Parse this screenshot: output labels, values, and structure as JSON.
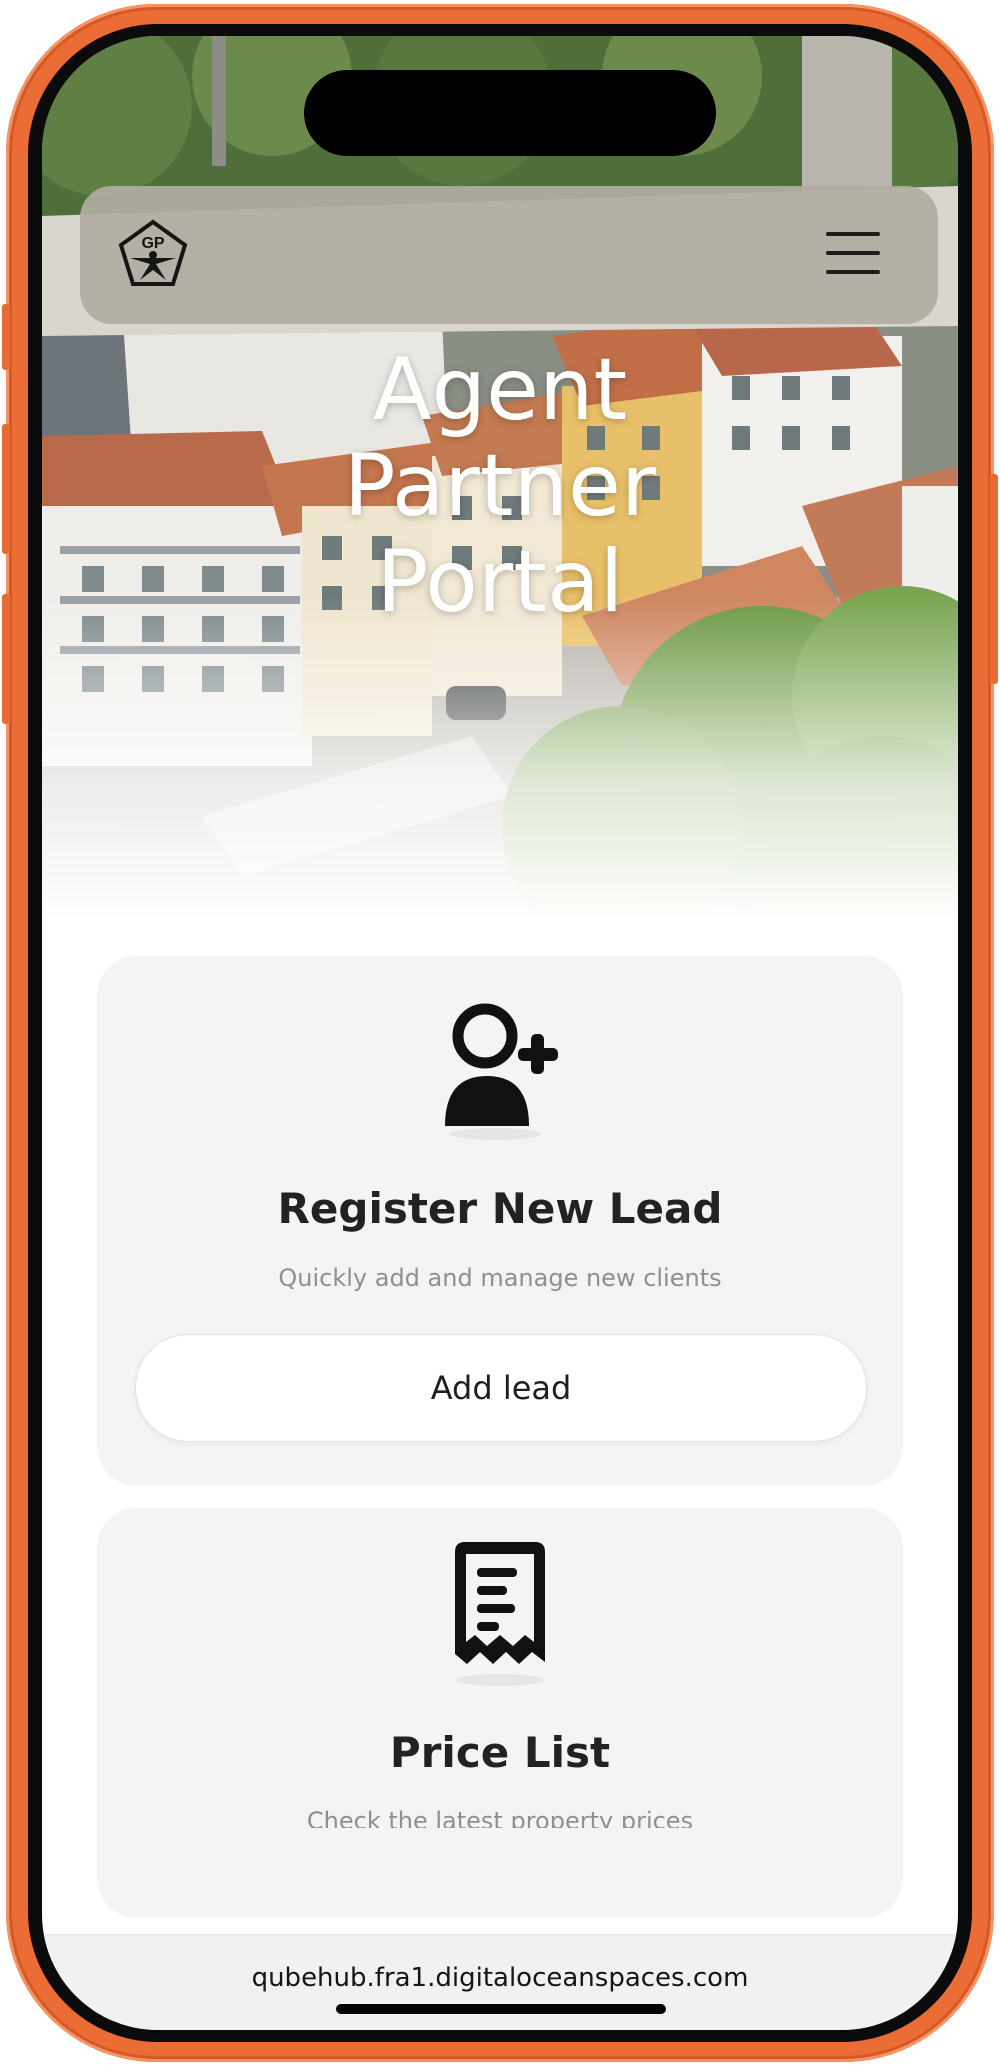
{
  "app": {
    "hero_title": [
      "Agent",
      "Partner",
      "Portal"
    ],
    "logo_text": "GP"
  },
  "cards": [
    {
      "icon": "add-user-icon",
      "title": "Register New Lead",
      "subtitle": "Quickly add and manage new clients",
      "button_label": "Add lead"
    },
    {
      "icon": "receipt-document-icon",
      "title": "Price List",
      "subtitle": "Check the latest property prices"
    }
  ],
  "browser": {
    "url": "qubehub.fra1.digitaloceanspaces.com"
  },
  "colors": {
    "frame": "#ec6c35",
    "navbar": "#b2aca3",
    "card_bg": "#f4f4f4",
    "text_dark": "#222222",
    "text_muted": "#8f8f8f"
  }
}
